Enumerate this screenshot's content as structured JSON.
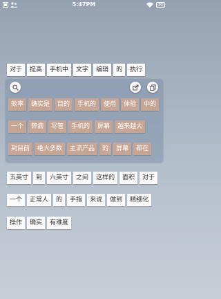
{
  "status_bar": {
    "time": "5:47PM",
    "battery": "50"
  },
  "top_row": [
    "对于",
    "提高",
    "手机中",
    "文字",
    "编辑",
    "的",
    "执行"
  ],
  "panel": {
    "rows": [
      [
        "效率",
        "确实是",
        "目的",
        "手机的",
        "使用",
        "体验",
        "中的"
      ],
      [
        "一个",
        "弊病",
        "尽管",
        "手机的",
        "屏幕",
        "越来越大"
      ],
      [
        "到目前",
        "绝大多数",
        "主流产品",
        "的",
        "屏幕",
        "都在"
      ]
    ]
  },
  "bottom_rows": [
    [
      "五英寸",
      "到",
      "六英寸",
      "之间",
      "这样的",
      "面积",
      "对于"
    ],
    [
      "一个",
      "正常人",
      "的",
      "手指",
      "来说",
      "做到",
      "精细化"
    ],
    [
      "操作",
      "确实",
      "有难度"
    ]
  ]
}
